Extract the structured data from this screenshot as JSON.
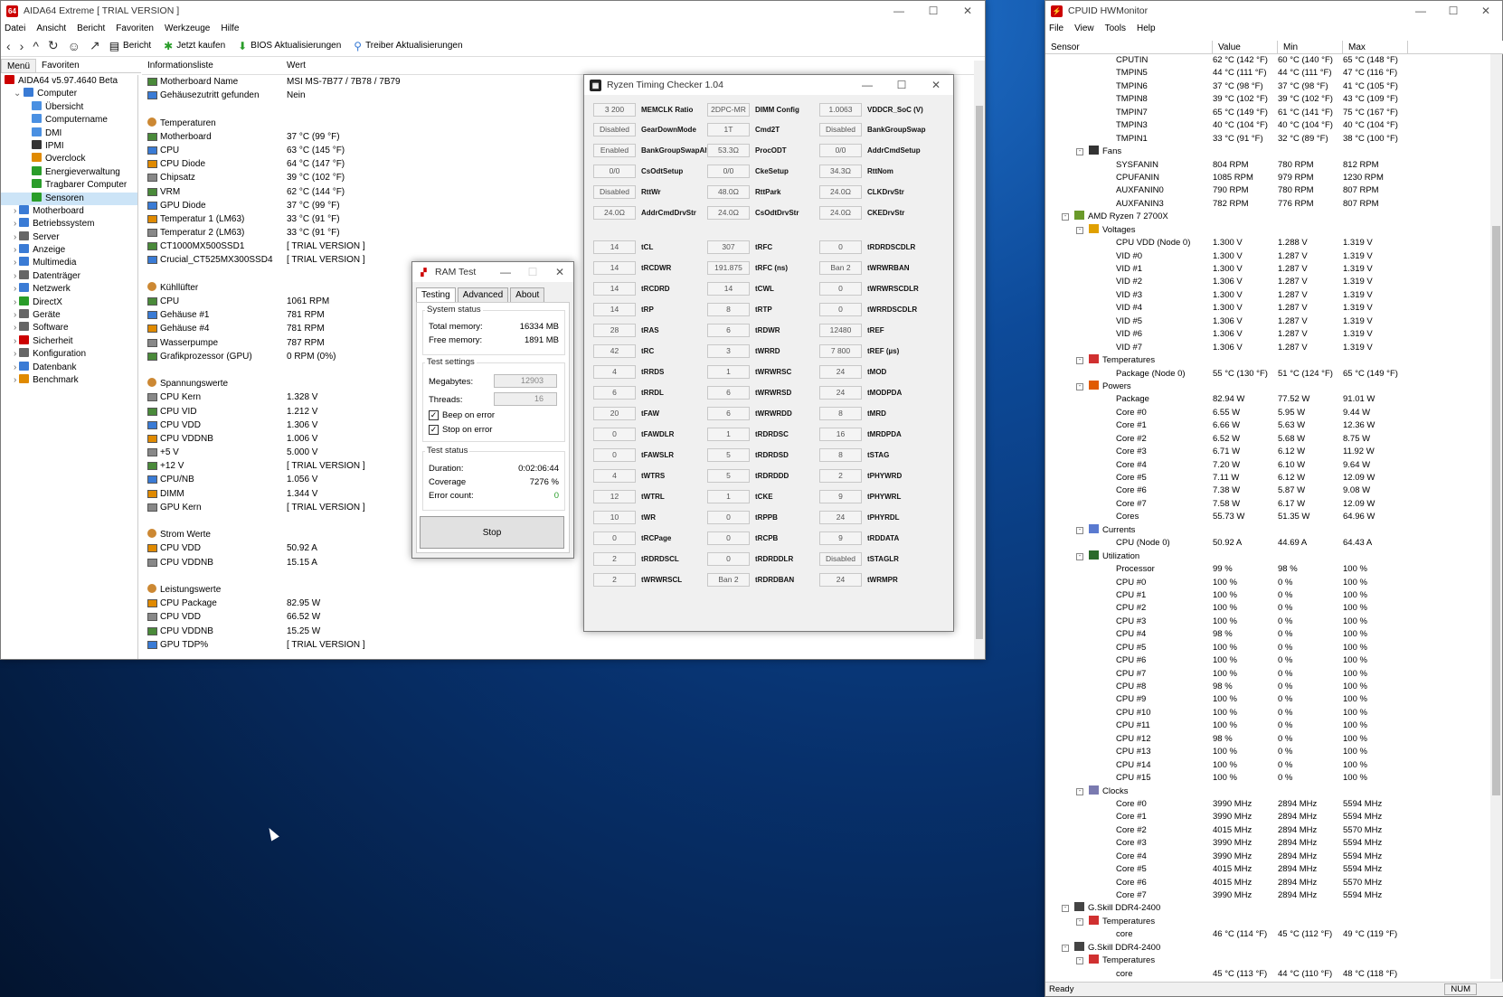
{
  "aida": {
    "title": "AIDA64 Extreme  [ TRIAL VERSION ]",
    "menu": [
      "Datei",
      "Ansicht",
      "Bericht",
      "Favoriten",
      "Werkzeuge",
      "Hilfe"
    ],
    "toolbar": {
      "report": "Bericht",
      "buy": "Jetzt kaufen",
      "bios": "BIOS Aktualisierungen",
      "driver": "Treiber Aktualisierungen"
    },
    "tabs": {
      "menu": "Menü",
      "fav": "Favoriten"
    },
    "tree": [
      {
        "label": "AIDA64 v5.97.4640 Beta",
        "indent": 0,
        "color": "#c00"
      },
      {
        "label": "Computer",
        "indent": 1,
        "color": "#3a7bd5"
      },
      {
        "label": "Übersicht",
        "indent": 3,
        "color": "#4a90e2"
      },
      {
        "label": "Computername",
        "indent": 3,
        "color": "#4a90e2"
      },
      {
        "label": "DMI",
        "indent": 3,
        "color": "#4a90e2"
      },
      {
        "label": "IPMI",
        "indent": 3,
        "color": "#333"
      },
      {
        "label": "Overclock",
        "indent": 3,
        "color": "#e08a00"
      },
      {
        "label": "Energieverwaltung",
        "indent": 3,
        "color": "#2a9d2a"
      },
      {
        "label": "Tragbarer Computer",
        "indent": 3,
        "color": "#2a9d2a"
      },
      {
        "label": "Sensoren",
        "indent": 3,
        "color": "#2a9d2a",
        "selected": true
      },
      {
        "label": "Motherboard",
        "indent": 1,
        "color": "#3a7bd5"
      },
      {
        "label": "Betriebssystem",
        "indent": 1,
        "color": "#3a7bd5"
      },
      {
        "label": "Server",
        "indent": 1,
        "color": "#666"
      },
      {
        "label": "Anzeige",
        "indent": 1,
        "color": "#3a7bd5"
      },
      {
        "label": "Multimedia",
        "indent": 1,
        "color": "#3a7bd5"
      },
      {
        "label": "Datenträger",
        "indent": 1,
        "color": "#666"
      },
      {
        "label": "Netzwerk",
        "indent": 1,
        "color": "#3a7bd5"
      },
      {
        "label": "DirectX",
        "indent": 1,
        "color": "#2a9d2a"
      },
      {
        "label": "Geräte",
        "indent": 1,
        "color": "#666"
      },
      {
        "label": "Software",
        "indent": 1,
        "color": "#666"
      },
      {
        "label": "Sicherheit",
        "indent": 1,
        "color": "#c00"
      },
      {
        "label": "Konfiguration",
        "indent": 1,
        "color": "#666"
      },
      {
        "label": "Datenbank",
        "indent": 1,
        "color": "#3a7bd5"
      },
      {
        "label": "Benchmark",
        "indent": 1,
        "color": "#e08a00"
      }
    ],
    "columns": {
      "info": "Informationsliste",
      "value": "Wert"
    },
    "rows": [
      {
        "n": "Motherboard Name",
        "v": "MSI MS-7B77 / 7B78 / 7B79"
      },
      {
        "n": "Gehäusezutritt gefunden",
        "v": "Nein"
      },
      {
        "n": "",
        "v": ""
      },
      {
        "n": "Temperaturen",
        "v": "",
        "grp": true
      },
      {
        "n": "Motherboard",
        "v": "37 °C  (99 °F)"
      },
      {
        "n": "CPU",
        "v": "63 °C  (145 °F)"
      },
      {
        "n": "CPU Diode",
        "v": "64 °C  (147 °F)"
      },
      {
        "n": "Chipsatz",
        "v": "39 °C  (102 °F)"
      },
      {
        "n": "VRM",
        "v": "62 °C  (144 °F)"
      },
      {
        "n": "GPU Diode",
        "v": "37 °C  (99 °F)"
      },
      {
        "n": "Temperatur 1 (LM63)",
        "v": "33 °C  (91 °F)"
      },
      {
        "n": "Temperatur 2 (LM63)",
        "v": "33 °C  (91 °F)"
      },
      {
        "n": "CT1000MX500SSD1",
        "v": "[ TRIAL VERSION ]"
      },
      {
        "n": "Crucial_CT525MX300SSD4",
        "v": "[ TRIAL VERSION ]"
      },
      {
        "n": "",
        "v": ""
      },
      {
        "n": "Kühllüfter",
        "v": "",
        "grp": true
      },
      {
        "n": "CPU",
        "v": "1061 RPM"
      },
      {
        "n": "Gehäuse #1",
        "v": "781 RPM"
      },
      {
        "n": "Gehäuse #4",
        "v": "781 RPM"
      },
      {
        "n": "Wasserpumpe",
        "v": "787 RPM"
      },
      {
        "n": "Grafikprozessor (GPU)",
        "v": "0 RPM  (0%)"
      },
      {
        "n": "",
        "v": ""
      },
      {
        "n": "Spannungswerte",
        "v": "",
        "grp": true
      },
      {
        "n": "CPU Kern",
        "v": "1.328 V"
      },
      {
        "n": "CPU VID",
        "v": "1.212 V"
      },
      {
        "n": "CPU VDD",
        "v": "1.306 V"
      },
      {
        "n": "CPU VDDNB",
        "v": "1.006 V"
      },
      {
        "n": "+5 V",
        "v": "5.000 V"
      },
      {
        "n": "+12 V",
        "v": "[ TRIAL VERSION ]"
      },
      {
        "n": "CPU/NB",
        "v": "1.056 V"
      },
      {
        "n": "DIMM",
        "v": "1.344 V"
      },
      {
        "n": "GPU Kern",
        "v": "[ TRIAL VERSION ]"
      },
      {
        "n": "",
        "v": ""
      },
      {
        "n": "Strom Werte",
        "v": "",
        "grp": true
      },
      {
        "n": "CPU VDD",
        "v": "50.92 A"
      },
      {
        "n": "CPU VDDNB",
        "v": "15.15 A"
      },
      {
        "n": "",
        "v": ""
      },
      {
        "n": "Leistungswerte",
        "v": "",
        "grp": true
      },
      {
        "n": "CPU Package",
        "v": "82.95 W"
      },
      {
        "n": "CPU VDD",
        "v": "66.52 W"
      },
      {
        "n": "CPU VDDNB",
        "v": "15.25 W"
      },
      {
        "n": "GPU TDP%",
        "v": "[ TRIAL VERSION ]"
      }
    ]
  },
  "rtc": {
    "title": "Ryzen Timing Checker 1.04",
    "col1": [
      [
        "3 200",
        "MEMCLK Ratio"
      ],
      [
        "Disabled",
        "GearDownMode"
      ],
      [
        "Enabled",
        "BankGroupSwapAlt"
      ],
      [
        "0/0",
        "CsOdtSetup"
      ],
      [
        "Disabled",
        "RttWr"
      ],
      [
        "24.0Ω",
        "AddrCmdDrvStr"
      ],
      [
        "14",
        "tCL"
      ],
      [
        "14",
        "tRCDWR"
      ],
      [
        "14",
        "tRCDRD"
      ],
      [
        "14",
        "tRP"
      ],
      [
        "28",
        "tRAS"
      ],
      [
        "42",
        "tRC"
      ],
      [
        "4",
        "tRRDS"
      ],
      [
        "6",
        "tRRDL"
      ],
      [
        "20",
        "tFAW"
      ],
      [
        "0",
        "tFAWDLR"
      ],
      [
        "0",
        "tFAWSLR"
      ],
      [
        "4",
        "tWTRS"
      ],
      [
        "12",
        "tWTRL"
      ],
      [
        "10",
        "tWR"
      ],
      [
        "0",
        "tRCPage"
      ],
      [
        "2",
        "tRDRDSCL"
      ],
      [
        "2",
        "tWRWRSCL"
      ]
    ],
    "col2": [
      [
        "2DPC-MR",
        "DIMM Config"
      ],
      [
        "1T",
        "Cmd2T"
      ],
      [
        "53.3Ω",
        "ProcODT"
      ],
      [
        "0/0",
        "CkeSetup"
      ],
      [
        "48.0Ω",
        "RttPark"
      ],
      [
        "24.0Ω",
        "CsOdtDrvStr"
      ],
      [
        "307",
        "tRFC"
      ],
      [
        "191.875",
        "tRFC (ns)"
      ],
      [
        "14",
        "tCWL"
      ],
      [
        "8",
        "tRTP"
      ],
      [
        "6",
        "tRDWR"
      ],
      [
        "3",
        "tWRRD"
      ],
      [
        "1",
        "tWRWRSC"
      ],
      [
        "6",
        "tWRWRSD"
      ],
      [
        "6",
        "tWRWRDD"
      ],
      [
        "1",
        "tRDRDSC"
      ],
      [
        "5",
        "tRDRDSD"
      ],
      [
        "5",
        "tRDRDDD"
      ],
      [
        "1",
        "tCKE"
      ],
      [
        "0",
        "tRPPB"
      ],
      [
        "0",
        "tRCPB"
      ],
      [
        "0",
        "tRDRDDLR"
      ],
      [
        "Ban 2",
        "tRDRDBAN"
      ]
    ],
    "col3": [
      [
        "1.0063",
        "VDDCR_SoC (V)"
      ],
      [
        "Disabled",
        "BankGroupSwap"
      ],
      [
        "0/0",
        "AddrCmdSetup"
      ],
      [
        "34.3Ω",
        "RttNom"
      ],
      [
        "24.0Ω",
        "CLKDrvStr"
      ],
      [
        "24.0Ω",
        "CKEDrvStr"
      ],
      [
        "0",
        "tRDRDSCDLR"
      ],
      [
        "Ban 2",
        "tWRWRBAN"
      ],
      [
        "0",
        "tWRWRSCDLR"
      ],
      [
        "0",
        "tWRRDSCDLR"
      ],
      [
        "12480",
        "tREF"
      ],
      [
        "7 800",
        "tREF (µs)"
      ],
      [
        "24",
        "tMOD"
      ],
      [
        "24",
        "tMODPDA"
      ],
      [
        "8",
        "tMRD"
      ],
      [
        "16",
        "tMRDPDA"
      ],
      [
        "8",
        "tSTAG"
      ],
      [
        "2",
        "tPHYWRD"
      ],
      [
        "9",
        "tPHYWRL"
      ],
      [
        "24",
        "tPHYRDL"
      ],
      [
        "9",
        "tRDDATA"
      ],
      [
        "Disabled",
        "tSTAGLR"
      ],
      [
        "24",
        "tWRMPR"
      ]
    ]
  },
  "ram": {
    "title": "RAM Test",
    "tabs": [
      "Testing",
      "Advanced",
      "About"
    ],
    "system_status": "System status",
    "total_label": "Total memory:",
    "total": "16334 MB",
    "free_label": "Free memory:",
    "free": "1891 MB",
    "settings": "Test settings",
    "mb_label": "Megabytes:",
    "mb": "12903",
    "threads_label": "Threads:",
    "threads": "16",
    "beep": "Beep on error",
    "stop_err": "Stop on error",
    "test_status": "Test status",
    "duration_label": "Duration:",
    "duration": "0:02:06:44",
    "coverage_label": "Coverage",
    "coverage": "7276 %",
    "errors_label": "Error count:",
    "errors": "0",
    "stop": "Stop"
  },
  "hwm": {
    "title": "CPUID HWMonitor",
    "menu": [
      "File",
      "View",
      "Tools",
      "Help"
    ],
    "columns": [
      "Sensor",
      "Value",
      "Min",
      "Max"
    ],
    "status": "Ready",
    "num": "NUM",
    "rows": [
      {
        "n": "CPUTIN",
        "v": "62 °C  (142 °F)",
        "mn": "60 °C  (140 °F)",
        "mx": "65 °C  (148 °F)",
        "d": 4
      },
      {
        "n": "TMPIN5",
        "v": "44 °C  (111 °F)",
        "mn": "44 °C  (111 °F)",
        "mx": "47 °C  (116 °F)",
        "d": 4
      },
      {
        "n": "TMPIN6",
        "v": "37 °C  (98 °F)",
        "mn": "37 °C  (98 °F)",
        "mx": "41 °C  (105 °F)",
        "d": 4
      },
      {
        "n": "TMPIN8",
        "v": "39 °C  (102 °F)",
        "mn": "39 °C  (102 °F)",
        "mx": "43 °C  (109 °F)",
        "d": 4
      },
      {
        "n": "TMPIN7",
        "v": "65 °C  (149 °F)",
        "mn": "61 °C  (141 °F)",
        "mx": "75 °C  (167 °F)",
        "d": 4
      },
      {
        "n": "TMPIN3",
        "v": "40 °C  (104 °F)",
        "mn": "40 °C  (104 °F)",
        "mx": "40 °C  (104 °F)",
        "d": 4
      },
      {
        "n": "TMPIN1",
        "v": "33 °C  (91 °F)",
        "mn": "32 °C  (89 °F)",
        "mx": "38 °C  (100 °F)",
        "d": 4
      },
      {
        "n": "Fans",
        "d": 2,
        "exp": "-",
        "icon": "#333"
      },
      {
        "n": "SYSFANIN",
        "v": "804 RPM",
        "mn": "780 RPM",
        "mx": "812 RPM",
        "d": 4
      },
      {
        "n": "CPUFANIN",
        "v": "1085 RPM",
        "mn": "979 RPM",
        "mx": "1230 RPM",
        "d": 4
      },
      {
        "n": "AUXFANIN0",
        "v": "790 RPM",
        "mn": "780 RPM",
        "mx": "807 RPM",
        "d": 4
      },
      {
        "n": "AUXFANIN3",
        "v": "782 RPM",
        "mn": "776 RPM",
        "mx": "807 RPM",
        "d": 4
      },
      {
        "n": "AMD Ryzen 7 2700X",
        "d": 1,
        "exp": "-",
        "icon": "#6a9a2a"
      },
      {
        "n": "Voltages",
        "d": 2,
        "exp": "-",
        "icon": "#e0a000"
      },
      {
        "n": "CPU VDD (Node 0)",
        "v": "1.300 V",
        "mn": "1.288 V",
        "mx": "1.319 V",
        "d": 4
      },
      {
        "n": "VID #0",
        "v": "1.300 V",
        "mn": "1.287 V",
        "mx": "1.319 V",
        "d": 4
      },
      {
        "n": "VID #1",
        "v": "1.300 V",
        "mn": "1.287 V",
        "mx": "1.319 V",
        "d": 4
      },
      {
        "n": "VID #2",
        "v": "1.306 V",
        "mn": "1.287 V",
        "mx": "1.319 V",
        "d": 4
      },
      {
        "n": "VID #3",
        "v": "1.300 V",
        "mn": "1.287 V",
        "mx": "1.319 V",
        "d": 4
      },
      {
        "n": "VID #4",
        "v": "1.300 V",
        "mn": "1.287 V",
        "mx": "1.319 V",
        "d": 4
      },
      {
        "n": "VID #5",
        "v": "1.306 V",
        "mn": "1.287 V",
        "mx": "1.319 V",
        "d": 4
      },
      {
        "n": "VID #6",
        "v": "1.306 V",
        "mn": "1.287 V",
        "mx": "1.319 V",
        "d": 4
      },
      {
        "n": "VID #7",
        "v": "1.306 V",
        "mn": "1.287 V",
        "mx": "1.319 V",
        "d": 4
      },
      {
        "n": "Temperatures",
        "d": 2,
        "exp": "-",
        "icon": "#d03030"
      },
      {
        "n": "Package (Node 0)",
        "v": "55 °C  (130 °F)",
        "mn": "51 °C  (124 °F)",
        "mx": "65 °C  (149 °F)",
        "d": 4
      },
      {
        "n": "Powers",
        "d": 2,
        "exp": "-",
        "icon": "#e05a00"
      },
      {
        "n": "Package",
        "v": "82.94 W",
        "mn": "77.52 W",
        "mx": "91.01 W",
        "d": 4
      },
      {
        "n": "Core #0",
        "v": "6.55 W",
        "mn": "5.95 W",
        "mx": "9.44 W",
        "d": 4
      },
      {
        "n": "Core #1",
        "v": "6.66 W",
        "mn": "5.63 W",
        "mx": "12.36 W",
        "d": 4
      },
      {
        "n": "Core #2",
        "v": "6.52 W",
        "mn": "5.68 W",
        "mx": "8.75 W",
        "d": 4
      },
      {
        "n": "Core #3",
        "v": "6.71 W",
        "mn": "6.12 W",
        "mx": "11.92 W",
        "d": 4
      },
      {
        "n": "Core #4",
        "v": "7.20 W",
        "mn": "6.10 W",
        "mx": "9.64 W",
        "d": 4
      },
      {
        "n": "Core #5",
        "v": "7.11 W",
        "mn": "6.12 W",
        "mx": "12.09 W",
        "d": 4
      },
      {
        "n": "Core #6",
        "v": "7.38 W",
        "mn": "5.87 W",
        "mx": "9.08 W",
        "d": 4
      },
      {
        "n": "Core #7",
        "v": "7.58 W",
        "mn": "6.17 W",
        "mx": "12.09 W",
        "d": 4
      },
      {
        "n": "Cores",
        "v": "55.73 W",
        "mn": "51.35 W",
        "mx": "64.96 W",
        "d": 4
      },
      {
        "n": "Currents",
        "d": 2,
        "exp": "-",
        "icon": "#5a7ad0"
      },
      {
        "n": "CPU (Node 0)",
        "v": "50.92 A",
        "mn": "44.69 A",
        "mx": "64.43 A",
        "d": 4
      },
      {
        "n": "Utilization",
        "d": 2,
        "exp": "-",
        "icon": "#2a6a2a"
      },
      {
        "n": "Processor",
        "v": "99 %",
        "mn": "98 %",
        "mx": "100 %",
        "d": 4
      },
      {
        "n": "CPU #0",
        "v": "100 %",
        "mn": "0 %",
        "mx": "100 %",
        "d": 4
      },
      {
        "n": "CPU #1",
        "v": "100 %",
        "mn": "0 %",
        "mx": "100 %",
        "d": 4
      },
      {
        "n": "CPU #2",
        "v": "100 %",
        "mn": "0 %",
        "mx": "100 %",
        "d": 4
      },
      {
        "n": "CPU #3",
        "v": "100 %",
        "mn": "0 %",
        "mx": "100 %",
        "d": 4
      },
      {
        "n": "CPU #4",
        "v": "98 %",
        "mn": "0 %",
        "mx": "100 %",
        "d": 4
      },
      {
        "n": "CPU #5",
        "v": "100 %",
        "mn": "0 %",
        "mx": "100 %",
        "d": 4
      },
      {
        "n": "CPU #6",
        "v": "100 %",
        "mn": "0 %",
        "mx": "100 %",
        "d": 4
      },
      {
        "n": "CPU #7",
        "v": "100 %",
        "mn": "0 %",
        "mx": "100 %",
        "d": 4
      },
      {
        "n": "CPU #8",
        "v": "98 %",
        "mn": "0 %",
        "mx": "100 %",
        "d": 4
      },
      {
        "n": "CPU #9",
        "v": "100 %",
        "mn": "0 %",
        "mx": "100 %",
        "d": 4
      },
      {
        "n": "CPU #10",
        "v": "100 %",
        "mn": "0 %",
        "mx": "100 %",
        "d": 4
      },
      {
        "n": "CPU #11",
        "v": "100 %",
        "mn": "0 %",
        "mx": "100 %",
        "d": 4
      },
      {
        "n": "CPU #12",
        "v": "98 %",
        "mn": "0 %",
        "mx": "100 %",
        "d": 4
      },
      {
        "n": "CPU #13",
        "v": "100 %",
        "mn": "0 %",
        "mx": "100 %",
        "d": 4
      },
      {
        "n": "CPU #14",
        "v": "100 %",
        "mn": "0 %",
        "mx": "100 %",
        "d": 4
      },
      {
        "n": "CPU #15",
        "v": "100 %",
        "mn": "0 %",
        "mx": "100 %",
        "d": 4
      },
      {
        "n": "Clocks",
        "d": 2,
        "exp": "-",
        "icon": "#7a7ab0"
      },
      {
        "n": "Core #0",
        "v": "3990 MHz",
        "mn": "2894 MHz",
        "mx": "5594 MHz",
        "d": 4
      },
      {
        "n": "Core #1",
        "v": "3990 MHz",
        "mn": "2894 MHz",
        "mx": "5594 MHz",
        "d": 4
      },
      {
        "n": "Core #2",
        "v": "4015 MHz",
        "mn": "2894 MHz",
        "mx": "5570 MHz",
        "d": 4
      },
      {
        "n": "Core #3",
        "v": "3990 MHz",
        "mn": "2894 MHz",
        "mx": "5594 MHz",
        "d": 4
      },
      {
        "n": "Core #4",
        "v": "3990 MHz",
        "mn": "2894 MHz",
        "mx": "5594 MHz",
        "d": 4
      },
      {
        "n": "Core #5",
        "v": "4015 MHz",
        "mn": "2894 MHz",
        "mx": "5594 MHz",
        "d": 4
      },
      {
        "n": "Core #6",
        "v": "4015 MHz",
        "mn": "2894 MHz",
        "mx": "5570 MHz",
        "d": 4
      },
      {
        "n": "Core #7",
        "v": "3990 MHz",
        "mn": "2894 MHz",
        "mx": "5594 MHz",
        "d": 4
      },
      {
        "n": "G.Skill DDR4-2400",
        "d": 1,
        "exp": "-",
        "icon": "#444"
      },
      {
        "n": "Temperatures",
        "d": 2,
        "exp": "-",
        "icon": "#d03030"
      },
      {
        "n": "core",
        "v": "46 °C  (114 °F)",
        "mn": "45 °C  (112 °F)",
        "mx": "49 °C  (119 °F)",
        "d": 4
      },
      {
        "n": "G.Skill DDR4-2400",
        "d": 1,
        "exp": "-",
        "icon": "#444"
      },
      {
        "n": "Temperatures",
        "d": 2,
        "exp": "-",
        "icon": "#d03030"
      },
      {
        "n": "core",
        "v": "45 °C  (113 °F)",
        "mn": "44 °C  (110 °F)",
        "mx": "48 °C  (118 °F)",
        "d": 4
      }
    ]
  }
}
